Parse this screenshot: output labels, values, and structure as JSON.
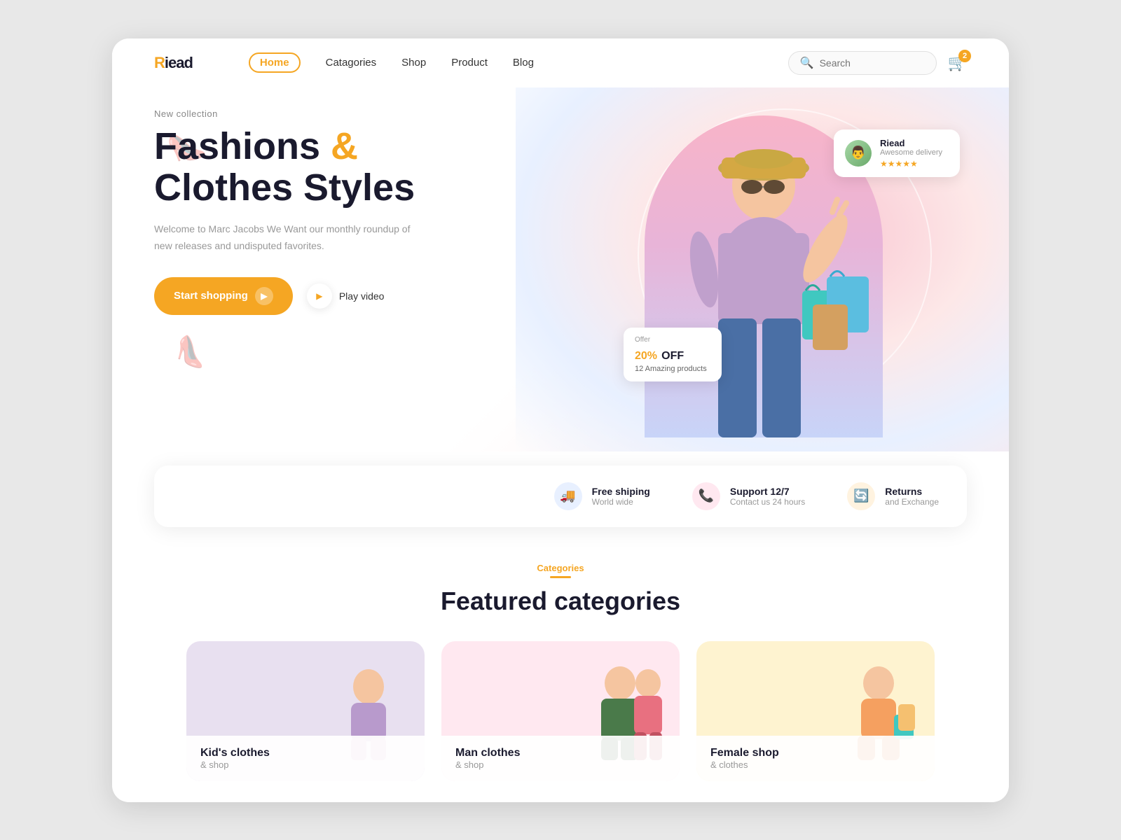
{
  "brand": {
    "name": "Riead",
    "name_prefix": "R",
    "name_suffix": "iead"
  },
  "nav": {
    "links": [
      {
        "id": "home",
        "label": "Home",
        "active": true
      },
      {
        "id": "categories",
        "label": "Catagories",
        "active": false
      },
      {
        "id": "shop",
        "label": "Shop",
        "active": false
      },
      {
        "id": "product",
        "label": "Product",
        "active": false
      },
      {
        "id": "blog",
        "label": "Blog",
        "active": false
      }
    ],
    "search_placeholder": "Search",
    "cart_count": "2"
  },
  "hero": {
    "new_collection_label": "New collection",
    "title_line1": "Fashions &",
    "title_line2": "Clothes Styles",
    "description": "Welcome to Marc Jacobs We Want our monthly roundup of new releases and undisputed favorites.",
    "start_button": "Start shopping",
    "play_button": "Play video",
    "offer": {
      "label": "Offer",
      "percent": "20%",
      "suffix": "OFF",
      "products": "12 Amazing products"
    },
    "review": {
      "name": "Riead",
      "subtitle": "Awesome delivery",
      "stars": "★★★★★"
    }
  },
  "services": [
    {
      "id": "shipping",
      "icon": "🚚",
      "icon_style": "blue",
      "title": "Free shiping",
      "subtitle": "World wide"
    },
    {
      "id": "support",
      "icon": "📞",
      "icon_style": "pink",
      "title": "Support 12/7",
      "subtitle": "Contact us 24 hours"
    },
    {
      "id": "returns",
      "icon": "🔄",
      "icon_style": "orange",
      "title": "Returns",
      "subtitle": "and Exchange"
    }
  ],
  "categories_section": {
    "label": "Categories",
    "title": "Featured categories"
  },
  "categories": [
    {
      "id": "kids",
      "title": "Kid's clothes",
      "subtitle": "& shop",
      "color_class": "kids"
    },
    {
      "id": "man",
      "title": "Man clothes",
      "subtitle": "& shop",
      "color_class": "man"
    },
    {
      "id": "female",
      "title": "Female shop",
      "subtitle": "& clothes",
      "color_class": "female"
    }
  ]
}
